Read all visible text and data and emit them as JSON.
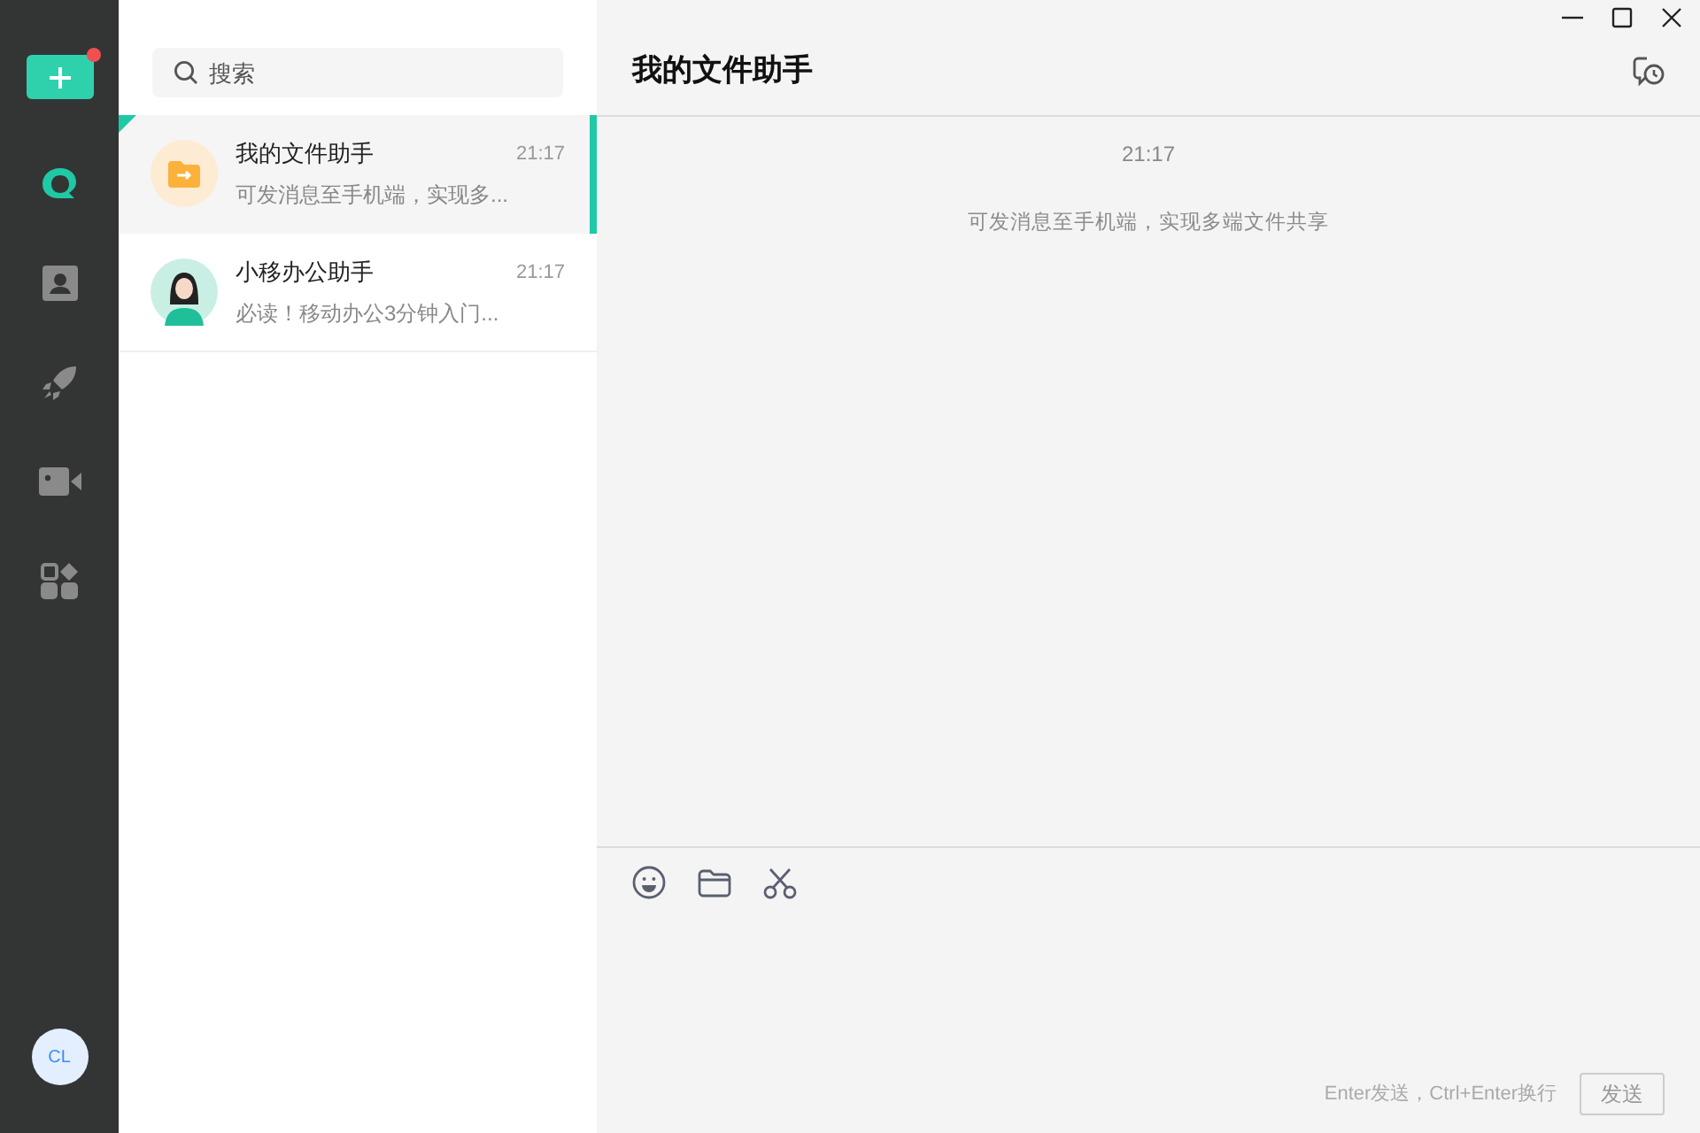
{
  "sidebar": {
    "add_button": {
      "has_badge": true
    },
    "items": [
      {
        "kind": "chat",
        "selected": true
      },
      {
        "kind": "contacts",
        "selected": false
      },
      {
        "kind": "apps",
        "selected": false
      },
      {
        "kind": "video",
        "selected": false
      },
      {
        "kind": "workbench",
        "selected": false
      }
    ],
    "avatar": "CL"
  },
  "search": {
    "placeholder": "搜索"
  },
  "conversations": [
    {
      "kind": "folder",
      "name": "我的文件助手",
      "time": "21:17",
      "preview": "可发消息至手机端，实现多...",
      "selected": true
    },
    {
      "kind": "person",
      "name": "小移办公助手",
      "time": "21:17",
      "preview": "必读！移动办公3分钟入门...",
      "selected": false
    }
  ],
  "chat": {
    "title": "我的文件助手",
    "messages": [
      {
        "kind": "time",
        "text": "21:17"
      },
      {
        "kind": "notice",
        "text": "可发消息至手机端，实现多端文件共享"
      }
    ],
    "hint": "Enter发送，Ctrl+Enter换行",
    "send": "发送"
  }
}
